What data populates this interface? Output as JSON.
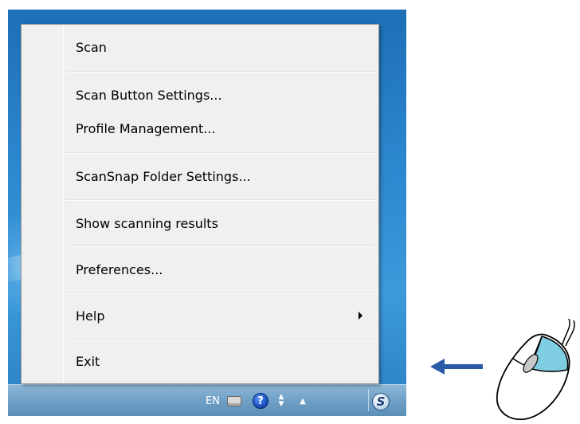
{
  "menu": {
    "items": [
      {
        "label": "Scan"
      },
      {
        "label": "Scan Button Settings..."
      },
      {
        "label": "Profile Management..."
      },
      {
        "label": "ScanSnap Folder Settings..."
      },
      {
        "label": "Show scanning results"
      },
      {
        "label": "Preferences..."
      },
      {
        "label": "Help",
        "has_submenu": true
      },
      {
        "label": "Exit"
      }
    ]
  },
  "tray": {
    "language": "EN",
    "help_glyph": "?",
    "scansnap_glyph": "S",
    "icons": [
      "keyboard-icon",
      "help-icon",
      "network-arrows-icon",
      "show-hidden-icons-icon",
      "scansnap-manager-icon"
    ]
  },
  "annotation": {
    "arrow_color": "#2a5aa8",
    "mouse_button_color": "#7fcde0"
  }
}
